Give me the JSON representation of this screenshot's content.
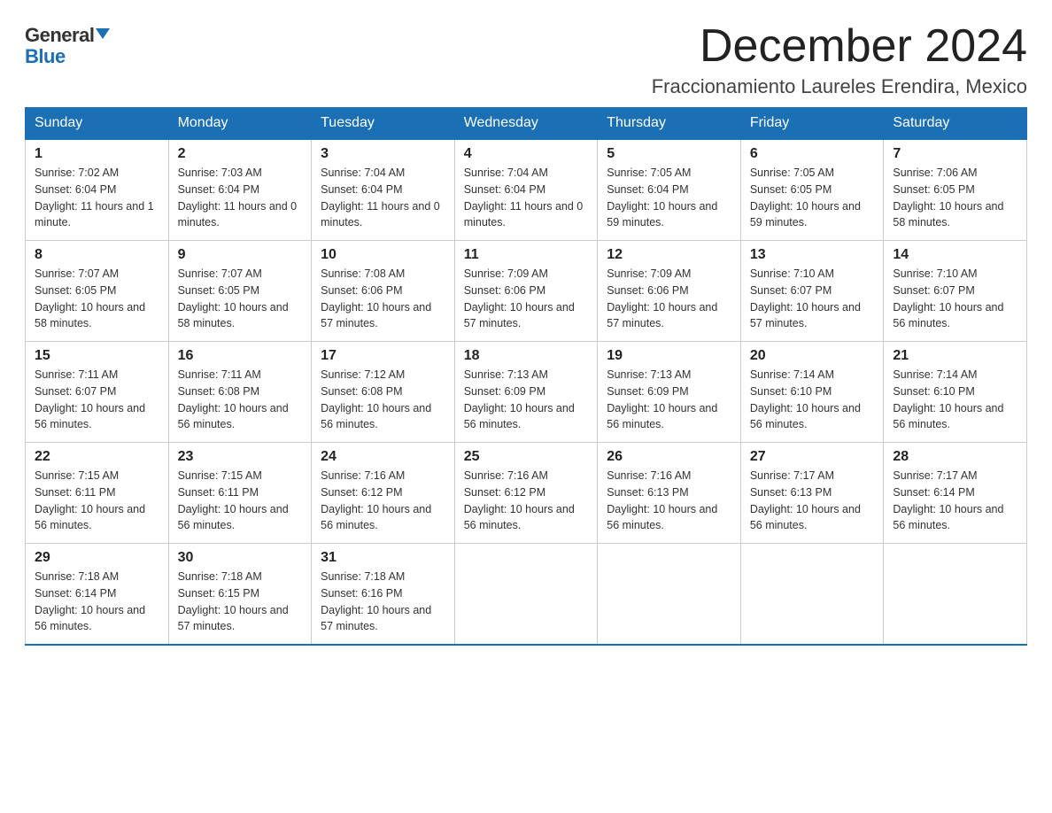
{
  "header": {
    "logo_general": "General",
    "logo_blue": "Blue",
    "month_title": "December 2024",
    "location": "Fraccionamiento Laureles Erendira, Mexico"
  },
  "days_of_week": [
    "Sunday",
    "Monday",
    "Tuesday",
    "Wednesday",
    "Thursday",
    "Friday",
    "Saturday"
  ],
  "weeks": [
    [
      {
        "day": "1",
        "sunrise": "7:02 AM",
        "sunset": "6:04 PM",
        "daylight": "11 hours and 1 minute."
      },
      {
        "day": "2",
        "sunrise": "7:03 AM",
        "sunset": "6:04 PM",
        "daylight": "11 hours and 0 minutes."
      },
      {
        "day": "3",
        "sunrise": "7:04 AM",
        "sunset": "6:04 PM",
        "daylight": "11 hours and 0 minutes."
      },
      {
        "day": "4",
        "sunrise": "7:04 AM",
        "sunset": "6:04 PM",
        "daylight": "11 hours and 0 minutes."
      },
      {
        "day": "5",
        "sunrise": "7:05 AM",
        "sunset": "6:04 PM",
        "daylight": "10 hours and 59 minutes."
      },
      {
        "day": "6",
        "sunrise": "7:05 AM",
        "sunset": "6:05 PM",
        "daylight": "10 hours and 59 minutes."
      },
      {
        "day": "7",
        "sunrise": "7:06 AM",
        "sunset": "6:05 PM",
        "daylight": "10 hours and 58 minutes."
      }
    ],
    [
      {
        "day": "8",
        "sunrise": "7:07 AM",
        "sunset": "6:05 PM",
        "daylight": "10 hours and 58 minutes."
      },
      {
        "day": "9",
        "sunrise": "7:07 AM",
        "sunset": "6:05 PM",
        "daylight": "10 hours and 58 minutes."
      },
      {
        "day": "10",
        "sunrise": "7:08 AM",
        "sunset": "6:06 PM",
        "daylight": "10 hours and 57 minutes."
      },
      {
        "day": "11",
        "sunrise": "7:09 AM",
        "sunset": "6:06 PM",
        "daylight": "10 hours and 57 minutes."
      },
      {
        "day": "12",
        "sunrise": "7:09 AM",
        "sunset": "6:06 PM",
        "daylight": "10 hours and 57 minutes."
      },
      {
        "day": "13",
        "sunrise": "7:10 AM",
        "sunset": "6:07 PM",
        "daylight": "10 hours and 57 minutes."
      },
      {
        "day": "14",
        "sunrise": "7:10 AM",
        "sunset": "6:07 PM",
        "daylight": "10 hours and 56 minutes."
      }
    ],
    [
      {
        "day": "15",
        "sunrise": "7:11 AM",
        "sunset": "6:07 PM",
        "daylight": "10 hours and 56 minutes."
      },
      {
        "day": "16",
        "sunrise": "7:11 AM",
        "sunset": "6:08 PM",
        "daylight": "10 hours and 56 minutes."
      },
      {
        "day": "17",
        "sunrise": "7:12 AM",
        "sunset": "6:08 PM",
        "daylight": "10 hours and 56 minutes."
      },
      {
        "day": "18",
        "sunrise": "7:13 AM",
        "sunset": "6:09 PM",
        "daylight": "10 hours and 56 minutes."
      },
      {
        "day": "19",
        "sunrise": "7:13 AM",
        "sunset": "6:09 PM",
        "daylight": "10 hours and 56 minutes."
      },
      {
        "day": "20",
        "sunrise": "7:14 AM",
        "sunset": "6:10 PM",
        "daylight": "10 hours and 56 minutes."
      },
      {
        "day": "21",
        "sunrise": "7:14 AM",
        "sunset": "6:10 PM",
        "daylight": "10 hours and 56 minutes."
      }
    ],
    [
      {
        "day": "22",
        "sunrise": "7:15 AM",
        "sunset": "6:11 PM",
        "daylight": "10 hours and 56 minutes."
      },
      {
        "day": "23",
        "sunrise": "7:15 AM",
        "sunset": "6:11 PM",
        "daylight": "10 hours and 56 minutes."
      },
      {
        "day": "24",
        "sunrise": "7:16 AM",
        "sunset": "6:12 PM",
        "daylight": "10 hours and 56 minutes."
      },
      {
        "day": "25",
        "sunrise": "7:16 AM",
        "sunset": "6:12 PM",
        "daylight": "10 hours and 56 minutes."
      },
      {
        "day": "26",
        "sunrise": "7:16 AM",
        "sunset": "6:13 PM",
        "daylight": "10 hours and 56 minutes."
      },
      {
        "day": "27",
        "sunrise": "7:17 AM",
        "sunset": "6:13 PM",
        "daylight": "10 hours and 56 minutes."
      },
      {
        "day": "28",
        "sunrise": "7:17 AM",
        "sunset": "6:14 PM",
        "daylight": "10 hours and 56 minutes."
      }
    ],
    [
      {
        "day": "29",
        "sunrise": "7:18 AM",
        "sunset": "6:14 PM",
        "daylight": "10 hours and 56 minutes."
      },
      {
        "day": "30",
        "sunrise": "7:18 AM",
        "sunset": "6:15 PM",
        "daylight": "10 hours and 57 minutes."
      },
      {
        "day": "31",
        "sunrise": "7:18 AM",
        "sunset": "6:16 PM",
        "daylight": "10 hours and 57 minutes."
      },
      null,
      null,
      null,
      null
    ]
  ]
}
